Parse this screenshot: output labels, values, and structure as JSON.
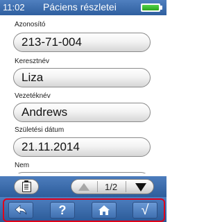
{
  "status_bar": {
    "time": "11:02",
    "title": "Páciens részletei",
    "battery_level": 1.0,
    "battery_color": "#3cc02f"
  },
  "form": {
    "fields": [
      {
        "label": "Azonosító",
        "value": "213-71-004"
      },
      {
        "label": "Keresztnév",
        "value": "Liza"
      },
      {
        "label": "Vezetéknév",
        "value": "Andrews"
      },
      {
        "label": "Születési dátum",
        "value": "21.11.2014"
      },
      {
        "label": "Nem",
        "value": ""
      }
    ]
  },
  "controls": {
    "page_indicator": "1/2",
    "clipboard_icon": "clipboard-icon",
    "prev_icon": "up-arrow-icon",
    "next_icon": "down-arrow-icon"
  },
  "nav": {
    "back_icon": "back-arrow-icon",
    "help_glyph": "?",
    "home_icon": "home-icon",
    "ok_glyph": "√",
    "highlight_color": "#e0001a"
  }
}
